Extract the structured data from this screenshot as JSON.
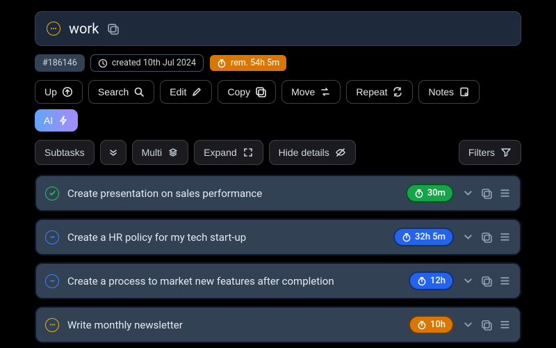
{
  "header": {
    "title": "work",
    "status_icon": "ellipsis",
    "id_badge": "#186146",
    "created_label": "created 10th Jul 2024",
    "remaining_label": "rem. 54h 5m"
  },
  "toolbar": {
    "up": "Up",
    "search": "Search",
    "edit": "Edit",
    "copy": "Copy",
    "move": "Move",
    "repeat": "Repeat",
    "notes": "Notes",
    "ai": "AI"
  },
  "subtaskBar": {
    "label": "Subtasks",
    "multi": "Multi",
    "expand": "Expand",
    "hide_details": "Hide details",
    "filters": "Filters"
  },
  "tasks": [
    {
      "status": "done",
      "title": "Create presentation on sales performance",
      "time": "30m",
      "time_color": "green"
    },
    {
      "status": "open",
      "title": "Create a HR policy for my tech start-up",
      "time": "32h 5m",
      "time_color": "blue"
    },
    {
      "status": "open",
      "title": "Create a process to market new features after completion",
      "time": "12h",
      "time_color": "blue"
    },
    {
      "status": "pending",
      "title": "Write monthly newsletter",
      "time": "10h",
      "time_color": "amber"
    }
  ],
  "icons": {
    "copy": "copy-icon",
    "clock": "clock-icon",
    "stopwatch": "stopwatch-icon"
  }
}
